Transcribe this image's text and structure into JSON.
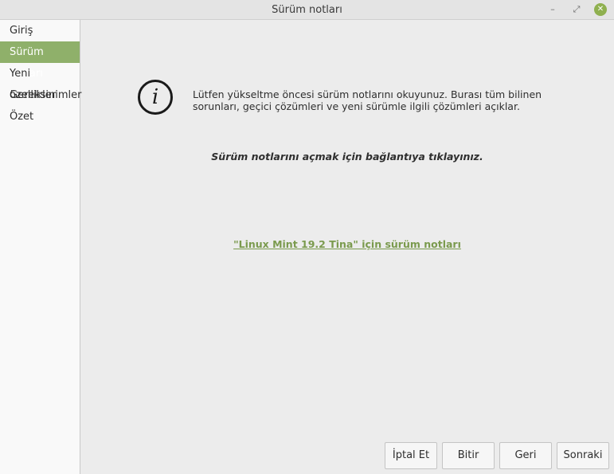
{
  "window": {
    "title": "Sürüm notları"
  },
  "sidebar": {
    "items": [
      {
        "label": "Giriş"
      },
      {
        "label": "Sürüm notları",
        "active": true
      },
      {
        "label": "Yeni özellikler"
      },
      {
        "label": "Gereksinimler"
      },
      {
        "label": "Özet"
      }
    ]
  },
  "main": {
    "icon": "info-icon",
    "message": "Lütfen yükseltme öncesi sürüm notlarını okuyunuz. Burası tüm bilinen sorunları, geçici çözümleri ve yeni sürümle ilgili çözümleri açıklar.",
    "link_text": "\"Linux Mint 19.2 Tina\" için sürüm notları",
    "hint": "Sürüm notlarını açmak için bağlantıya tıklayınız."
  },
  "buttons": {
    "cancel": "İptal Et",
    "finish": "Bitir",
    "back": "Geri",
    "next": "Sonraki"
  },
  "colors": {
    "accent": "#8fb06a",
    "link": "#7a9a4d",
    "close": "#8fb04f"
  }
}
